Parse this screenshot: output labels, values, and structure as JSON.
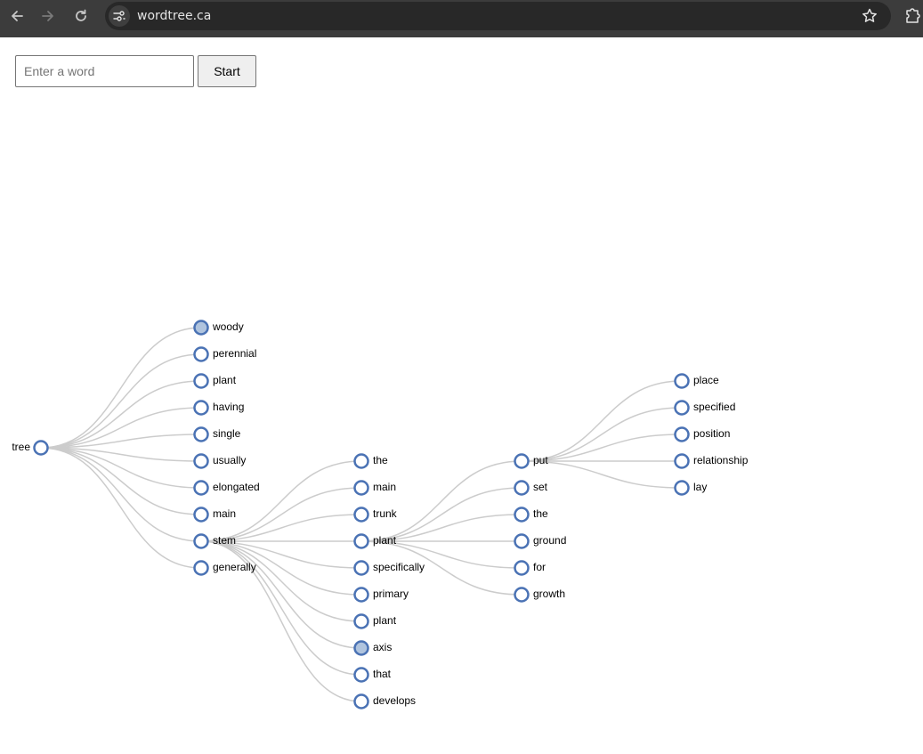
{
  "browser": {
    "url": "wordtree.ca",
    "icons": [
      "back-arrow-icon",
      "forward-arrow-icon",
      "reload-icon",
      "site-settings-icon",
      "bookmark-star-icon",
      "extensions-icon"
    ]
  },
  "search": {
    "placeholder": "Enter a word",
    "value": "",
    "start_label": "Start"
  },
  "colors": {
    "node_stroke": "#4a72b4",
    "node_fill": "#ffffff",
    "node_fill_collapsed": "#b0c4de",
    "link": "#cccccc"
  },
  "tree": {
    "word": "tree",
    "children": [
      {
        "word": "woody",
        "collapsed": true
      },
      {
        "word": "perennial"
      },
      {
        "word": "plant"
      },
      {
        "word": "having"
      },
      {
        "word": "single"
      },
      {
        "word": "usually"
      },
      {
        "word": "elongated"
      },
      {
        "word": "main"
      },
      {
        "word": "stem",
        "children": [
          {
            "word": "the"
          },
          {
            "word": "main"
          },
          {
            "word": "trunk"
          },
          {
            "word": "plant",
            "children": [
              {
                "word": "put",
                "children": [
                  {
                    "word": "place"
                  },
                  {
                    "word": "specified"
                  },
                  {
                    "word": "position"
                  },
                  {
                    "word": "relationship"
                  },
                  {
                    "word": "lay"
                  }
                ]
              },
              {
                "word": "set"
              },
              {
                "word": "the"
              },
              {
                "word": "ground"
              },
              {
                "word": "for"
              },
              {
                "word": "growth"
              }
            ]
          },
          {
            "word": "specifically"
          },
          {
            "word": "primary"
          },
          {
            "word": "plant"
          },
          {
            "word": "axis",
            "collapsed": true
          },
          {
            "word": "that"
          },
          {
            "word": "develops"
          }
        ]
      },
      {
        "word": "generally"
      }
    ]
  }
}
